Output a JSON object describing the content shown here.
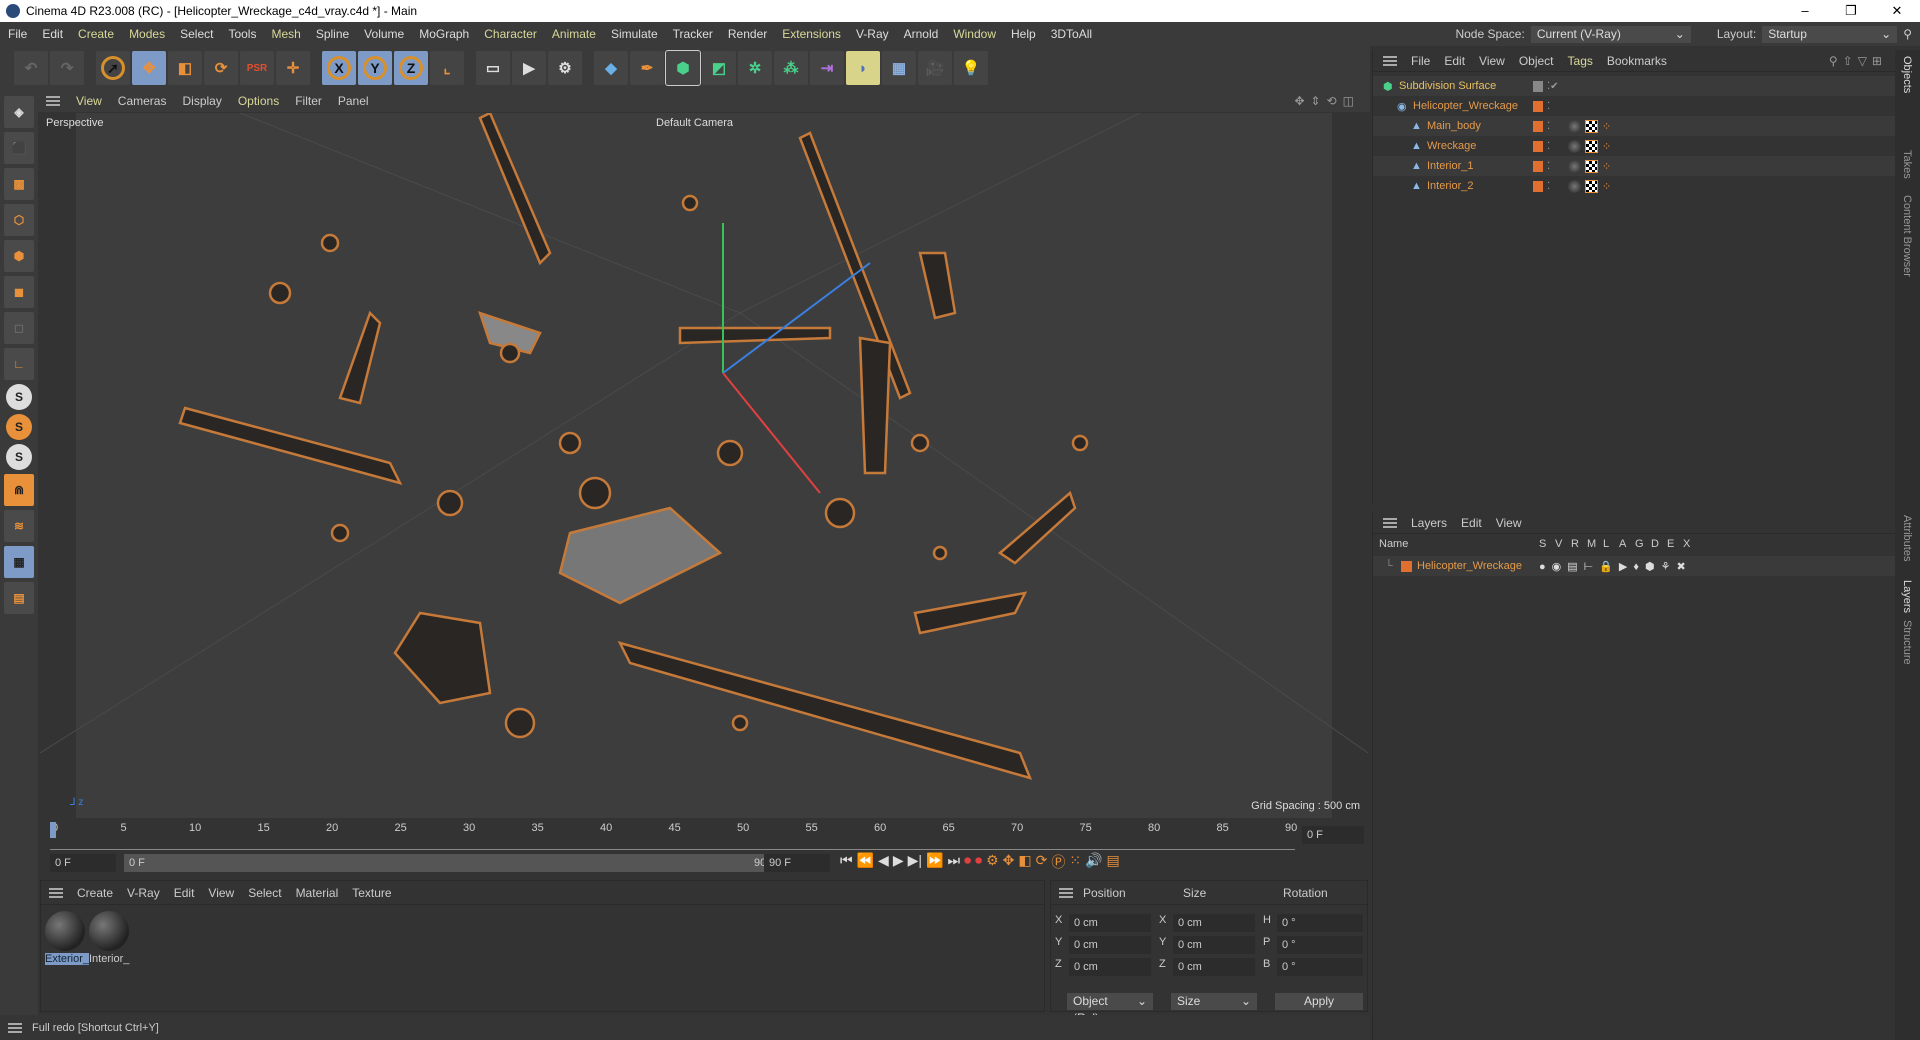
{
  "window": {
    "title": "Cinema 4D R23.008 (RC) - [Helicopter_Wreckage_c4d_vray.c4d *] - Main",
    "controls": [
      "–",
      "❐",
      "✕"
    ]
  },
  "menu": [
    {
      "label": "File",
      "hl": false
    },
    {
      "label": "Edit",
      "hl": false
    },
    {
      "label": "Create",
      "hl": true
    },
    {
      "label": "Modes",
      "hl": true
    },
    {
      "label": "Select",
      "hl": false
    },
    {
      "label": "Tools",
      "hl": false
    },
    {
      "label": "Mesh",
      "hl": true
    },
    {
      "label": "Spline",
      "hl": false
    },
    {
      "label": "Volume",
      "hl": false
    },
    {
      "label": "MoGraph",
      "hl": false
    },
    {
      "label": "Character",
      "hl": true
    },
    {
      "label": "Animate",
      "hl": true
    },
    {
      "label": "Simulate",
      "hl": false
    },
    {
      "label": "Tracker",
      "hl": false
    },
    {
      "label": "Render",
      "hl": false
    },
    {
      "label": "Extensions",
      "hl": true
    },
    {
      "label": "V-Ray",
      "hl": false
    },
    {
      "label": "Arnold",
      "hl": false
    },
    {
      "label": "Window",
      "hl": true
    },
    {
      "label": "Help",
      "hl": false
    },
    {
      "label": "3DToAll",
      "hl": false
    }
  ],
  "nodespace": {
    "label": "Node Space:",
    "value": "Current (V-Ray)",
    "layout_label": "Layout:",
    "layout_value": "Startup"
  },
  "viewport": {
    "menu": [
      "View",
      "Cameras",
      "Display",
      "Options",
      "Filter",
      "Panel"
    ],
    "view_name": "Perspective",
    "camera": "Default Camera",
    "grid_spacing": "Grid Spacing : 500 cm"
  },
  "timeline": {
    "ticks": [
      "0",
      "5",
      "10",
      "15",
      "20",
      "25",
      "30",
      "35",
      "40",
      "45",
      "50",
      "55",
      "60",
      "65",
      "70",
      "75",
      "80",
      "85",
      "90"
    ],
    "current_frame": "0 F",
    "start": "0 F",
    "range_start": "0 F",
    "range_end": "90 F",
    "end": "90 F"
  },
  "materials": {
    "menu": [
      "Create",
      "V-Ray",
      "Edit",
      "View",
      "Select",
      "Material",
      "Texture"
    ],
    "items": [
      "Exterior_",
      "Interior_"
    ]
  },
  "coords": {
    "headers": [
      "Position",
      "Size",
      "Rotation"
    ],
    "rows": [
      {
        "a": "X",
        "p": "0 cm",
        "b": "X",
        "s": "0 cm",
        "c": "H",
        "r": "0 °"
      },
      {
        "a": "Y",
        "p": "0 cm",
        "b": "Y",
        "s": "0 cm",
        "c": "P",
        "r": "0 °"
      },
      {
        "a": "Z",
        "p": "0 cm",
        "b": "Z",
        "s": "0 cm",
        "c": "B",
        "r": "0 °"
      }
    ],
    "mode": "Object (Rel)",
    "size_mode": "Size",
    "apply": "Apply"
  },
  "status": "Full redo [Shortcut Ctrl+Y]",
  "objects": {
    "menu": [
      "File",
      "Edit",
      "View",
      "Object",
      "Tags",
      "Bookmarks"
    ],
    "items": [
      {
        "name": "Subdivision Surface",
        "indent": 0
      },
      {
        "name": "Helicopter_Wreckage",
        "indent": 1
      },
      {
        "name": "Main_body",
        "indent": 2
      },
      {
        "name": "Wreckage",
        "indent": 2
      },
      {
        "name": "Interior_1",
        "indent": 2
      },
      {
        "name": "Interior_2",
        "indent": 2
      }
    ]
  },
  "layers": {
    "menu": [
      "Layers",
      "Edit",
      "View"
    ],
    "columns": [
      "Name",
      "S",
      "V",
      "R",
      "M",
      "L",
      "A",
      "G",
      "D",
      "E",
      "X"
    ],
    "items": [
      "Helicopter_Wreckage"
    ]
  },
  "sidetabs": [
    "Objects",
    "Takes",
    "Content Browser",
    "Attributes",
    "Layers",
    "Structure"
  ]
}
